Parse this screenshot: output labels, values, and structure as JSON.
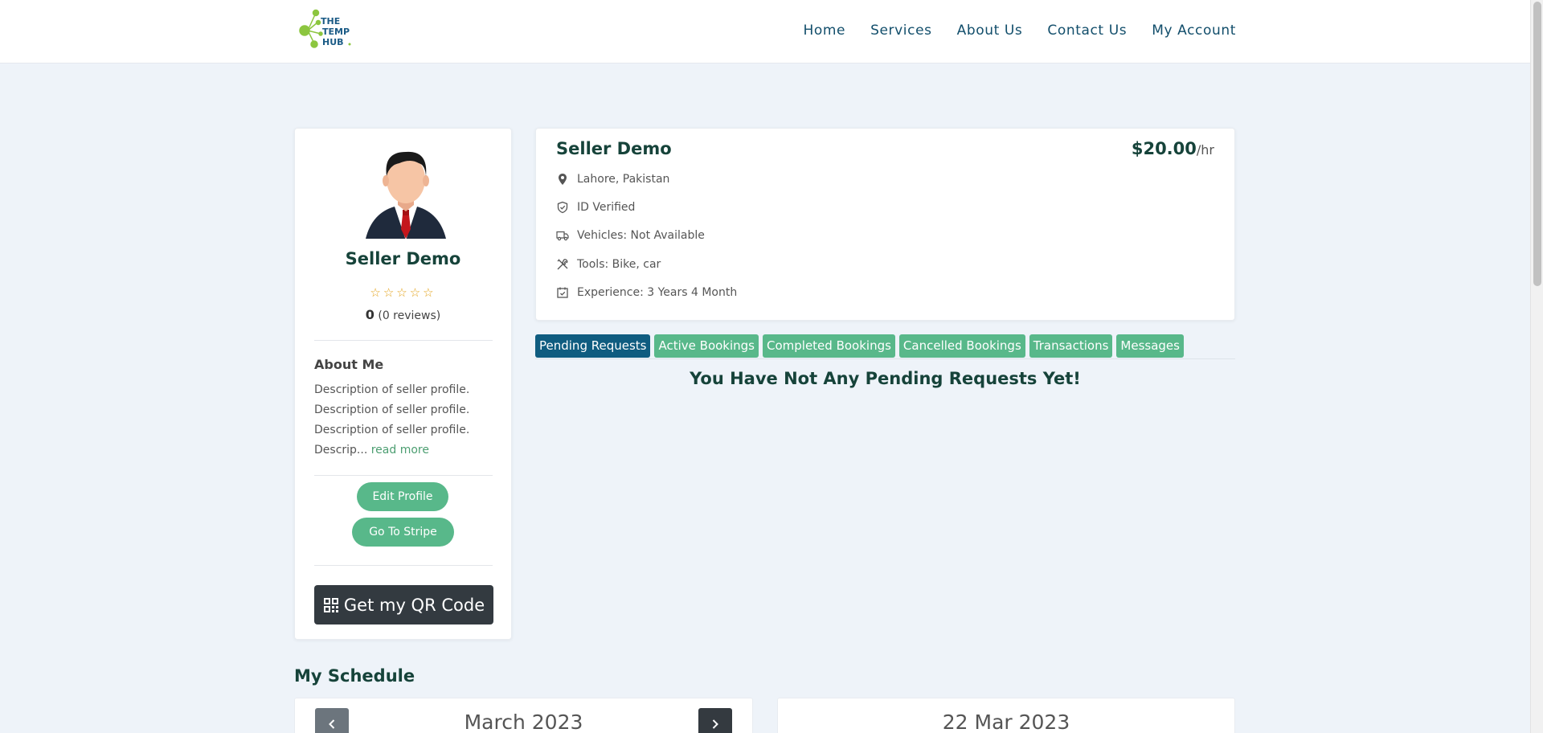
{
  "brand": {
    "logo_line1": "THE",
    "logo_line2": "TEMP",
    "logo_line3": "HUB"
  },
  "nav": {
    "items": [
      "Home",
      "Services",
      "About Us",
      "Contact Us",
      "My Account"
    ]
  },
  "profile": {
    "name": "Seller Demo",
    "stars_glyphs": "☆☆☆☆☆",
    "rating_value": "0",
    "rating_reviews": "(0 reviews)",
    "about_title": "About Me",
    "about_text": "Description of seller profile. Description of seller profile. Description of seller profile. Descrip...",
    "read_more": "read more",
    "edit_profile": "Edit Profile",
    "go_to_stripe": "Go To Stripe",
    "qr_button": "Get my QR Code"
  },
  "info": {
    "name": "Seller Demo",
    "rate": "$20.00",
    "rate_unit": "/hr",
    "location": "Lahore, Pakistan",
    "verification": "ID Verified",
    "vehicles": "Vehicles: Not Available",
    "tools": "Tools: Bike, car",
    "experience": "Experience: 3 Years 4 Month"
  },
  "tabs": {
    "items": [
      "Pending Requests",
      "Active Bookings",
      "Completed Bookings",
      "Cancelled Bookings",
      "Transactions",
      "Messages"
    ],
    "active": "Pending Requests"
  },
  "empty_message": "You Have Not Any Pending Requests Yet!",
  "schedule": {
    "title": "My Schedule",
    "month": "March 2023",
    "selected_date": "22 Mar 2023"
  },
  "colors": {
    "primary_green": "#58b88a",
    "active_tab": "#0f5c80",
    "heading": "#16433a",
    "nav_text": "#124e6b",
    "page_bg": "#eef3f9"
  }
}
